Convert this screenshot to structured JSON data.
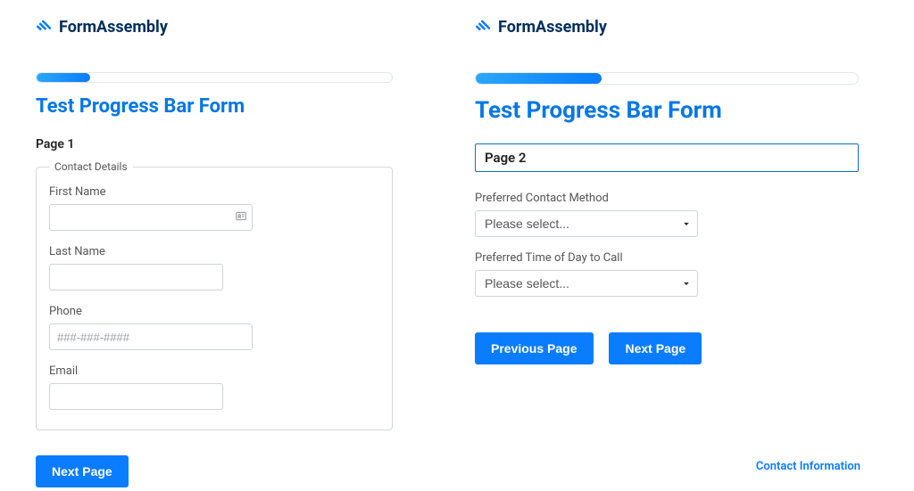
{
  "brand": {
    "name": "FormAssembly"
  },
  "left": {
    "title": "Test Progress Bar Form",
    "page_label": "Page 1",
    "progress_percent": 15,
    "group_legend": "Contact Details",
    "fields": {
      "first_name": {
        "label": "First Name",
        "value": "",
        "placeholder": ""
      },
      "last_name": {
        "label": "Last Name",
        "value": "",
        "placeholder": ""
      },
      "phone": {
        "label": "Phone",
        "value": "",
        "placeholder": "###-###-####"
      },
      "email": {
        "label": "Email",
        "value": "",
        "placeholder": ""
      }
    },
    "next_label": "Next Page"
  },
  "right": {
    "title": "Test Progress Bar Form",
    "page_label": "Page 2",
    "progress_percent": 33,
    "fields": {
      "contact_method": {
        "label": "Preferred Contact Method",
        "selected": "Please select..."
      },
      "call_time": {
        "label": "Preferred Time of Day to Call",
        "selected": "Please select..."
      }
    },
    "prev_label": "Previous Page",
    "next_label": "Next Page",
    "footer_link": "Contact Information"
  }
}
